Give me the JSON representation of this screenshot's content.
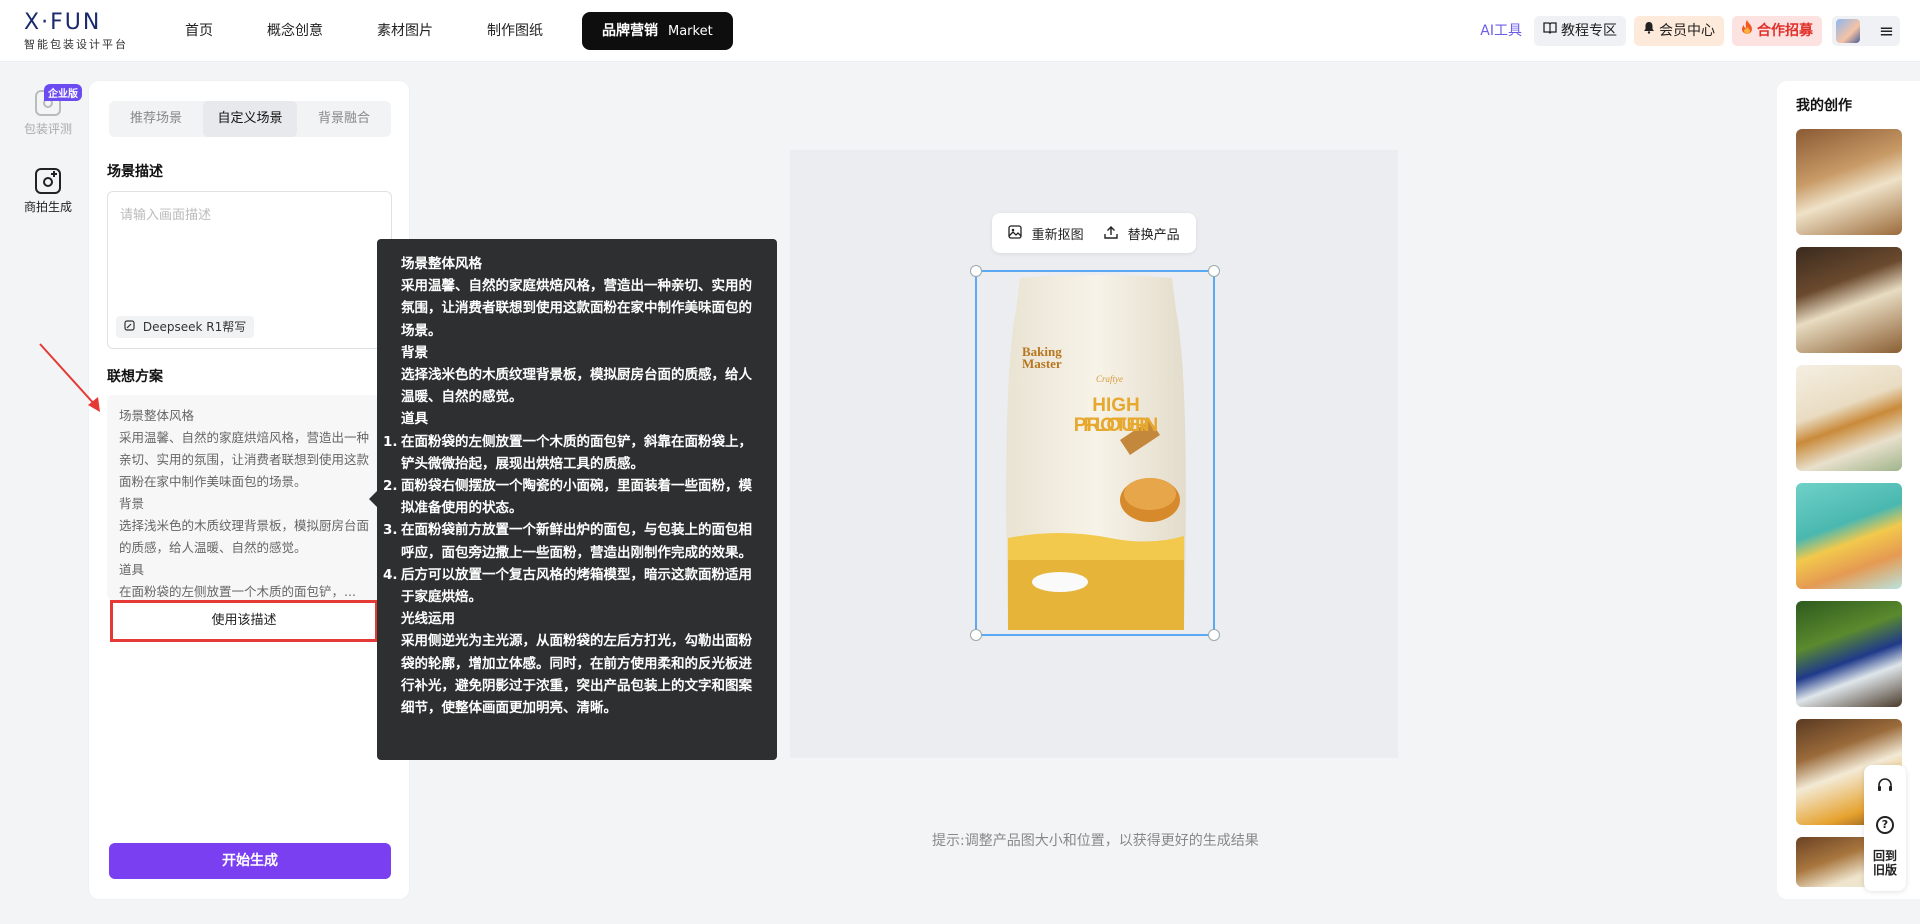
{
  "brand": {
    "logo": "X·FUN",
    "tagline": "智能包装设计平台"
  },
  "nav": [
    {
      "label": "首页"
    },
    {
      "label": "概念创意"
    },
    {
      "label": "素材图片"
    },
    {
      "label": "制作图纸"
    },
    {
      "label": "品牌营销",
      "sub": "Market",
      "active": true
    }
  ],
  "header_right": {
    "ai_tools": "AI工具",
    "tutorial": "教程专区",
    "member": "会员中心",
    "recruit": "合作招募"
  },
  "rail": [
    {
      "label": "包装评测",
      "badge": "企业版",
      "disabled": true
    },
    {
      "label": "商拍生成"
    }
  ],
  "panel": {
    "tabs": [
      "推荐场景",
      "自定义场景",
      "背景融合"
    ],
    "active_tab": "自定义场景",
    "scene_title": "场景描述",
    "scene_placeholder": "请输入画面描述",
    "deepseek_label": "Deepseek R1帮写",
    "assoc_title": "联想方案",
    "assoc_lines": [
      "场景整体风格",
      "采用温馨、自然的家庭烘焙风格，营造出一种亲切、实用的氛围，让消费者联想到使用这款面粉在家中制作美味面包的场景。",
      "背景",
      "选择浅米色的木质纹理背景板，模拟厨房台面的质感，给人温暖、自然的感觉。",
      "道具",
      "在面粉袋的左侧放置一个木质的面包铲，..."
    ],
    "use_button": "使用该描述",
    "start_button": "开始生成"
  },
  "tooltip": {
    "h_style": "场景整体风格",
    "style": "采用温馨、自然的家庭烘焙风格，营造出一种亲切、实用的氛围，让消费者联想到使用这款面粉在家中制作美味面包的场景。",
    "h_bg": "背景",
    "bg": "选择浅米色的木质纹理背景板，模拟厨房台面的质感，给人温暖、自然的感觉。",
    "h_props": "道具",
    "props": [
      "在面粉袋的左侧放置一个木质的面包铲，斜靠在面粉袋上，铲头微微抬起，展现出烘焙工具的质感。",
      "面粉袋右侧摆放一个陶瓷的小面碗，里面装着一些面粉，模拟准备使用的状态。",
      "在面粉袋前方放置一个新鲜出炉的面包，与包装上的面包相呼应，面包旁边撒上一些面粉，营造出刚制作完成的效果。",
      "后方可以放置一个复古风格的烤箱模型，暗示这款面粉适用于家庭烘焙。"
    ],
    "h_light": "光线运用",
    "light": "采用侧逆光为主光源，从面粉袋的左后方打光，勾勒出面粉袋的轮廓，增加立体感。同时，在前方使用柔和的反光板进行补光，避免阴影过于浓重，突出产品包装上的文字和图案细节，使整体画面更加明亮、清晰。"
  },
  "canvas": {
    "recutout": "重新抠图",
    "replace": "替换产品",
    "bag_brand": "Baking Master",
    "bag_script": "Craftye",
    "bag_title1": "HIGH PROTEIN",
    "bag_title2": "FLOUR",
    "hint": "提示:调整产品图大小和位置，以获得更好的生成结果"
  },
  "right_panel": {
    "title": "我的创作",
    "back_label_1": "回到",
    "back_label_2": "旧版"
  },
  "colors": {
    "accent": "#7b3ff2",
    "selection": "#5aa9f5",
    "highlight": "#e53935"
  }
}
